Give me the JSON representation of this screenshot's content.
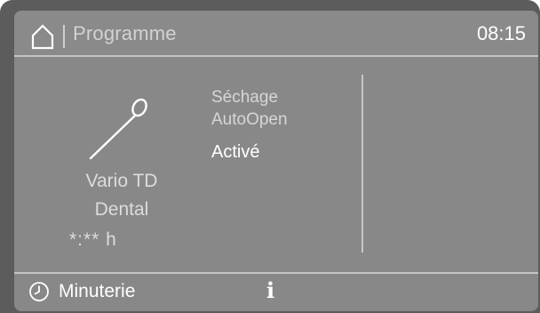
{
  "header": {
    "title": "Programme",
    "time": "08:15",
    "home_icon": "home-icon"
  },
  "program": {
    "icon": "dental-mirror-icon",
    "name_line1": "Vario TD",
    "name_line2": "Dental",
    "duration": "*:** h"
  },
  "options": {
    "label_line1": "Séchage",
    "label_line2": "AutoOpen",
    "value": "Activé"
  },
  "footer": {
    "timer_icon": "clock-icon",
    "timer_label": "Minuterie",
    "info_icon": "info-icon",
    "info_glyph": "i"
  },
  "colors": {
    "bezel": "#5c5c5c",
    "screen": "#888888",
    "text_primary": "#ffffff",
    "text_secondary": "#d6d6d6"
  }
}
